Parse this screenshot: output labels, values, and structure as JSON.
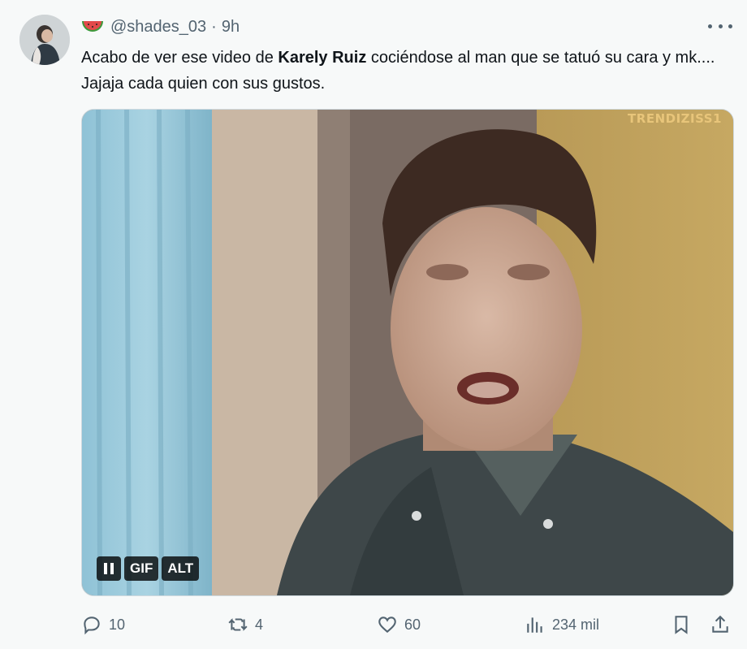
{
  "tweet": {
    "handle": "@shades_03",
    "separator": "·",
    "time": "9h",
    "text_before": "Acabo de ver ese video de ",
    "text_bold": "Karely Ruiz",
    "text_after": " cociéndose al man que se tatuó su cara y mk.... Jajaja cada quien con sus gustos."
  },
  "media": {
    "watermark": "TRENDIZISS1",
    "gif_label": "GIF",
    "alt_label": "ALT"
  },
  "actions": {
    "replies": "10",
    "reposts": "4",
    "likes": "60",
    "views": "234 mil"
  },
  "icons": [
    "watermelon-icon",
    "more-icon",
    "pause-icon",
    "reply-icon",
    "repost-icon",
    "like-icon",
    "views-icon",
    "bookmark-icon",
    "share-icon"
  ],
  "colors": {
    "secondary_text": "#536471",
    "primary_text": "#0f1419",
    "background": "#f7f9f9"
  }
}
